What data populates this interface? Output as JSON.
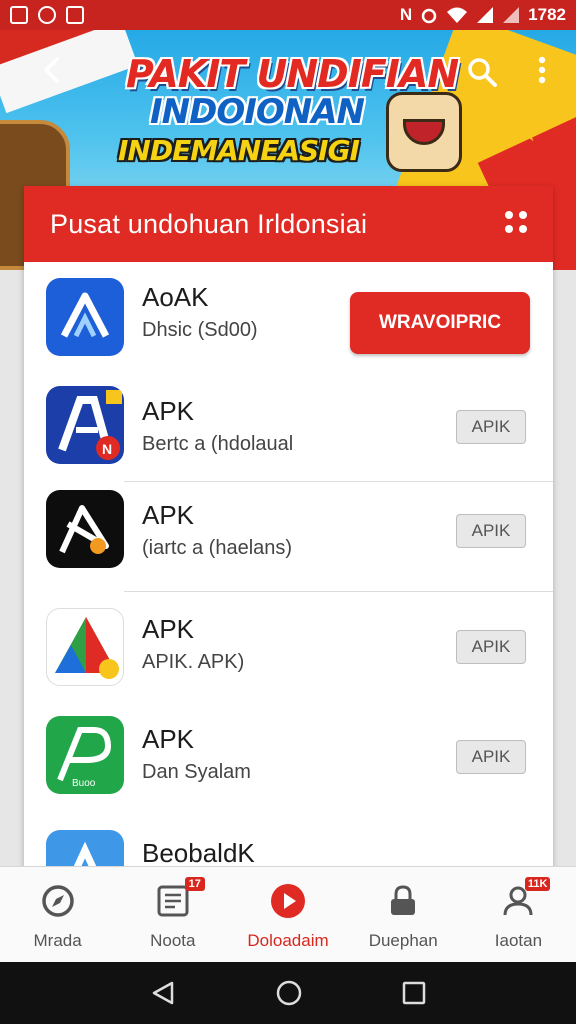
{
  "status_bar": {
    "time": "1782",
    "carrier": "N"
  },
  "banner": {
    "title": "PAKIT UNDIFIAN",
    "subtitle1": "INDOIONAN",
    "subtitle2": "INDEMANEASIGI"
  },
  "card": {
    "title": "Pusat undohuan Irldonsiai",
    "apps": [
      {
        "name": "AoAK",
        "desc": "Dhsic (Sd00)",
        "button": "WRAVOIPRIC",
        "primary": true
      },
      {
        "name": "APK",
        "desc": "Bertc a (hdolaual",
        "button": "APIK"
      },
      {
        "name": "APK",
        "desc": "(iartc a (haelans)",
        "button": "APIK"
      },
      {
        "name": "APK",
        "desc": "APIK. APK)",
        "button": "APIK"
      },
      {
        "name": "APK",
        "desc": "Dan Syalam",
        "button": "APIK"
      },
      {
        "name": "BeobaldK",
        "desc": ""
      }
    ]
  },
  "bottom_nav": [
    {
      "label": "Mrada",
      "icon": "compass-icon"
    },
    {
      "label": "Noota",
      "icon": "news-icon",
      "badge": "17"
    },
    {
      "label": "Doloadaim",
      "icon": "play-icon",
      "active": true
    },
    {
      "label": "Duephan",
      "icon": "lock-icon"
    },
    {
      "label": "Iaotan",
      "icon": "profile-icon",
      "badge": "11K"
    }
  ],
  "colors": {
    "accent": "#e02a24",
    "status_bar": "#c8241f",
    "banner_sky": "#25a9e6"
  }
}
